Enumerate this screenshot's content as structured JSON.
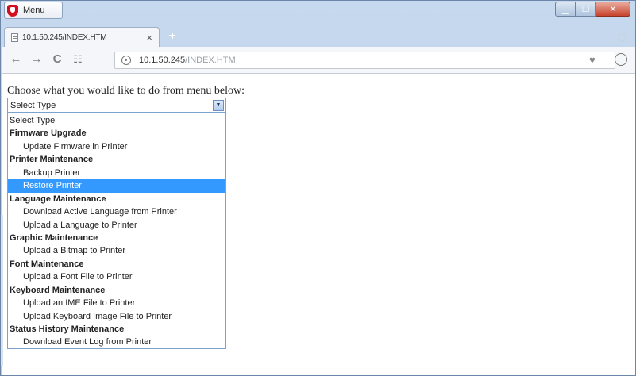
{
  "window": {
    "menu_label": "Menu",
    "controls": {
      "minimize": "▁",
      "maximize": "☐",
      "close": "✕"
    }
  },
  "tab": {
    "title": "10.1.50.245/INDEX.HTM",
    "close": "×",
    "new_tab": "+"
  },
  "navbar": {
    "back": "←",
    "forward": "→",
    "reload": "C",
    "speed_dial": "☷",
    "url_host": "10.1.50.245",
    "url_path": "/INDEX.HTM",
    "bookmark": "♥",
    "download": "⊕"
  },
  "page": {
    "prompt": "Choose what you would like to do from menu below:",
    "select_value": "Select Type",
    "select_arrow": "▼",
    "options": [
      {
        "label": "Select Type",
        "kind": "plain"
      },
      {
        "label": "Firmware Upgrade",
        "kind": "group"
      },
      {
        "label": "Update Firmware in Printer",
        "kind": "child"
      },
      {
        "label": "Printer Maintenance",
        "kind": "group"
      },
      {
        "label": "Backup Printer",
        "kind": "child"
      },
      {
        "label": "Restore Printer",
        "kind": "child",
        "selected": true
      },
      {
        "label": "Language Maintenance",
        "kind": "group"
      },
      {
        "label": "Download Active Language from Printer",
        "kind": "child"
      },
      {
        "label": "Upload a Language to Printer",
        "kind": "child"
      },
      {
        "label": "Graphic Maintenance",
        "kind": "group"
      },
      {
        "label": "Upload a Bitmap to Printer",
        "kind": "child"
      },
      {
        "label": "Font Maintenance",
        "kind": "group"
      },
      {
        "label": "Upload a Font File to Printer",
        "kind": "child"
      },
      {
        "label": "Keyboard Maintenance",
        "kind": "group"
      },
      {
        "label": "Upload an IME File to Printer",
        "kind": "child"
      },
      {
        "label": "Upload Keyboard Image File to Printer",
        "kind": "child"
      },
      {
        "label": "Status History Maintenance",
        "kind": "group"
      },
      {
        "label": "Download Event Log from Printer",
        "kind": "child"
      }
    ]
  },
  "colors": {
    "selected_option_bg": "#3399ff",
    "brand_red": "#d40e20"
  }
}
